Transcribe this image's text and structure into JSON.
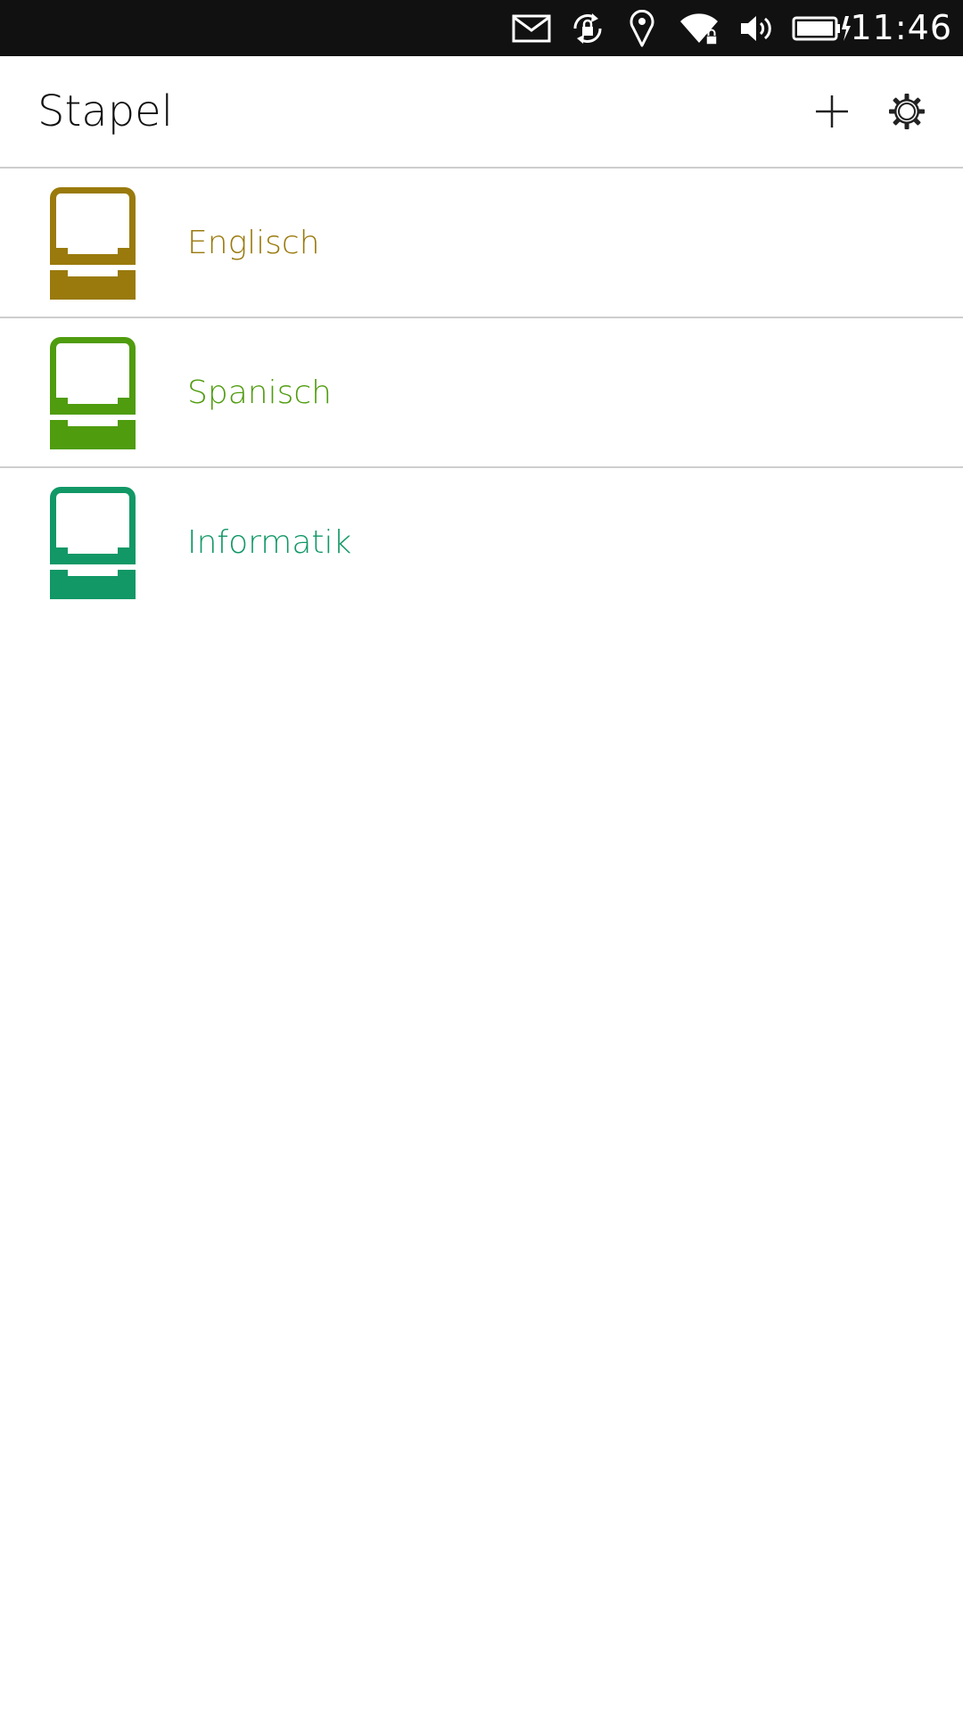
{
  "status_bar": {
    "time": "11:46",
    "icons": [
      "mail-icon",
      "rotation-lock-icon",
      "location-icon",
      "wifi-icon",
      "volume-icon",
      "battery-charging-icon"
    ]
  },
  "header": {
    "title": "Stapel",
    "add_icon": "plus-icon",
    "settings_icon": "gear-icon"
  },
  "decks": [
    {
      "label": "Englisch",
      "color": "#9a7a0c",
      "icon": "card-box-icon"
    },
    {
      "label": "Spanisch",
      "color": "#4f9c0e",
      "icon": "card-box-icon"
    },
    {
      "label": "Informatik",
      "color": "#119866",
      "icon": "card-box-icon"
    }
  ]
}
